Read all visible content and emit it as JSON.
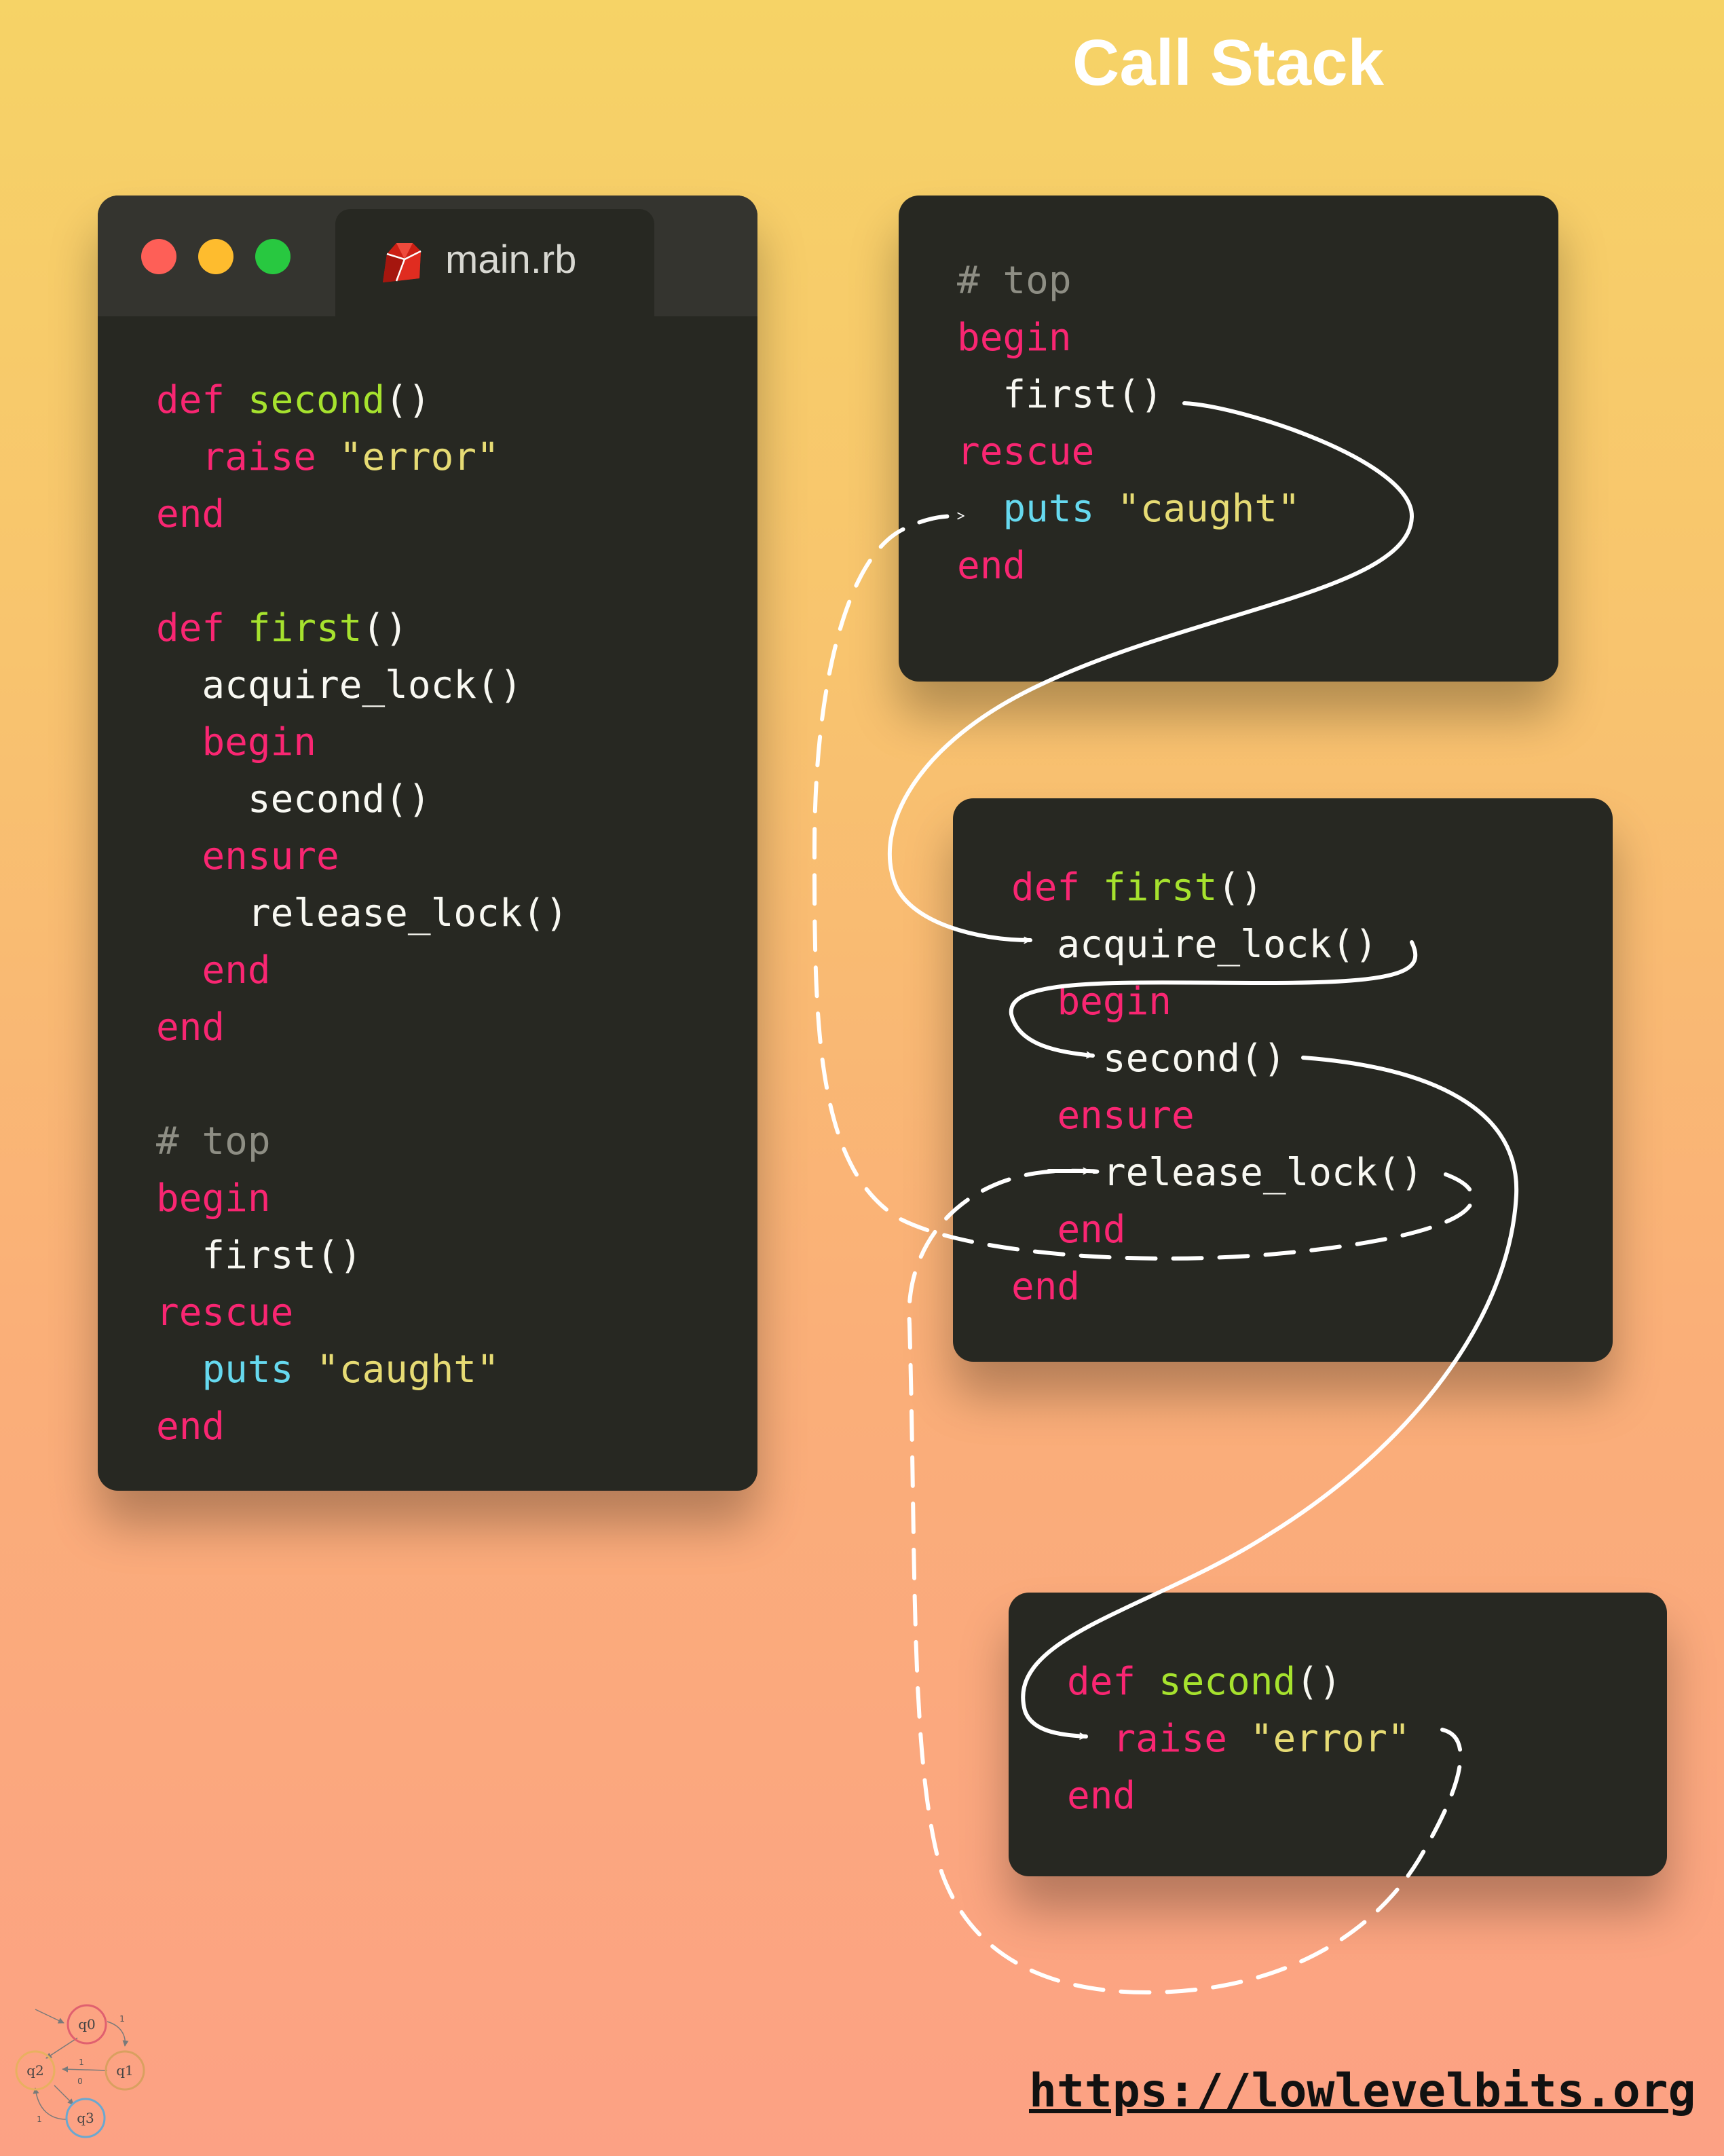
{
  "title": "Call Stack",
  "editor": {
    "tab_label": "main.rb",
    "icon": "ruby-icon",
    "window_controls": [
      "close",
      "minimize",
      "maximize"
    ],
    "lines": [
      [
        "def",
        " ",
        "second",
        "()"
      ],
      [
        "  ",
        "raise",
        " ",
        "\"error\""
      ],
      [
        "end"
      ],
      [
        ""
      ],
      [
        "def",
        " ",
        "first",
        "()"
      ],
      [
        "  acquire_lock()"
      ],
      [
        "  ",
        "begin"
      ],
      [
        "    second()"
      ],
      [
        "  ",
        "ensure"
      ],
      [
        "    release_lock()"
      ],
      [
        "  ",
        "end"
      ],
      [
        "end"
      ],
      [
        ""
      ],
      [
        "# top"
      ],
      [
        "begin"
      ],
      [
        "  first()"
      ],
      [
        "rescue"
      ],
      [
        "  ",
        "puts",
        " ",
        "\"caught\""
      ],
      [
        "end"
      ]
    ]
  },
  "stack": {
    "top": [
      [
        "# top"
      ],
      [
        "begin"
      ],
      [
        "  first()"
      ],
      [
        "rescue"
      ],
      [
        "  ",
        "puts",
        " ",
        "\"caught\""
      ],
      [
        "end"
      ]
    ],
    "first": [
      [
        "def",
        " ",
        "first",
        "()"
      ],
      [
        "  acquire_lock()"
      ],
      [
        "  ",
        "begin"
      ],
      [
        "    second()"
      ],
      [
        "  ",
        "ensure"
      ],
      [
        "    release_lock()"
      ],
      [
        "  ",
        "end"
      ],
      [
        "end"
      ]
    ],
    "second": [
      [
        "def",
        " ",
        "second",
        "()"
      ],
      [
        "  ",
        "raise",
        " ",
        "\"error\""
      ],
      [
        "end"
      ]
    ]
  },
  "colors": {
    "background_top": "#f6d366",
    "background_bottom": "#fca184",
    "panel": "#272822",
    "keyword": "#f92672",
    "function_name": "#a6e22e",
    "string": "#e6db74",
    "builtin": "#66d9ef",
    "comment": "#8e8e84",
    "text": "#f8f8f2"
  },
  "footer": {
    "url": "https://lowlevelbits.org",
    "logo": {
      "states": [
        "q0",
        "q1",
        "q2",
        "q3"
      ],
      "edge_labels": [
        "1",
        "1",
        "0",
        "1"
      ]
    }
  }
}
